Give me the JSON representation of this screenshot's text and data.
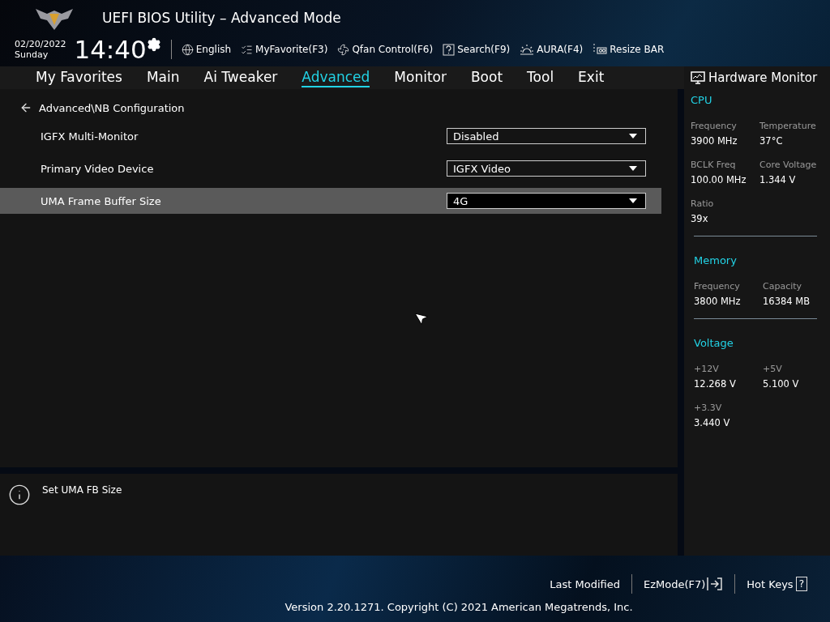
{
  "header": {
    "title": "UEFI BIOS Utility – Advanced Mode",
    "date": "02/20/2022",
    "day": "Sunday",
    "time": "14:40",
    "tools": [
      {
        "kind": "globe",
        "label": "English"
      },
      {
        "kind": "favorite",
        "label": "MyFavorite(F3)"
      },
      {
        "kind": "fan",
        "label": "Qfan Control(F6)"
      },
      {
        "kind": "search",
        "label": "Search(F9)"
      },
      {
        "kind": "aura",
        "label": "AURA(F4)"
      },
      {
        "kind": "resize",
        "label": "Resize BAR"
      }
    ]
  },
  "tabs": [
    {
      "label": "My Favorites",
      "selected": false
    },
    {
      "label": "Main",
      "selected": false
    },
    {
      "label": "Ai Tweaker",
      "selected": false
    },
    {
      "label": "Advanced",
      "selected": true
    },
    {
      "label": "Monitor",
      "selected": false
    },
    {
      "label": "Boot",
      "selected": false
    },
    {
      "label": "Tool",
      "selected": false
    },
    {
      "label": "Exit",
      "selected": false
    }
  ],
  "breadcrumb": "Advanced\\NB Configuration",
  "settings": [
    {
      "label": "IGFX Multi-Monitor",
      "value": "Disabled",
      "selected": false
    },
    {
      "label": "Primary Video Device",
      "value": "IGFX Video",
      "selected": false
    },
    {
      "label": "UMA Frame Buffer Size",
      "value": "4G",
      "selected": true
    }
  ],
  "help": "Set UMA FB Size",
  "hardware_monitor": {
    "title": "Hardware Monitor",
    "sections": [
      {
        "title": "CPU",
        "items": [
          {
            "label": "Frequency",
            "value": "3900 MHz"
          },
          {
            "label": "Temperature",
            "value": "37°C"
          },
          {
            "label": "BCLK Freq",
            "value": "100.00 MHz"
          },
          {
            "label": "Core Voltage",
            "value": "1.344 V"
          },
          {
            "label": "Ratio",
            "value": "39x"
          }
        ]
      },
      {
        "title": "Memory",
        "items": [
          {
            "label": "Frequency",
            "value": "3800 MHz"
          },
          {
            "label": "Capacity",
            "value": "16384 MB"
          }
        ]
      },
      {
        "title": "Voltage",
        "items": [
          {
            "label": "+12V",
            "value": "12.268 V"
          },
          {
            "label": "+5V",
            "value": "5.100 V"
          },
          {
            "label": "+3.3V",
            "value": "3.440 V"
          }
        ]
      }
    ]
  },
  "footer": {
    "last_modified": "Last Modified",
    "ezmode": "EzMode(F7)",
    "hot_keys": "Hot Keys",
    "hot_keys_key": "?",
    "version": "Version 2.20.1271. Copyright (C) 2021 American Megatrends, Inc."
  }
}
